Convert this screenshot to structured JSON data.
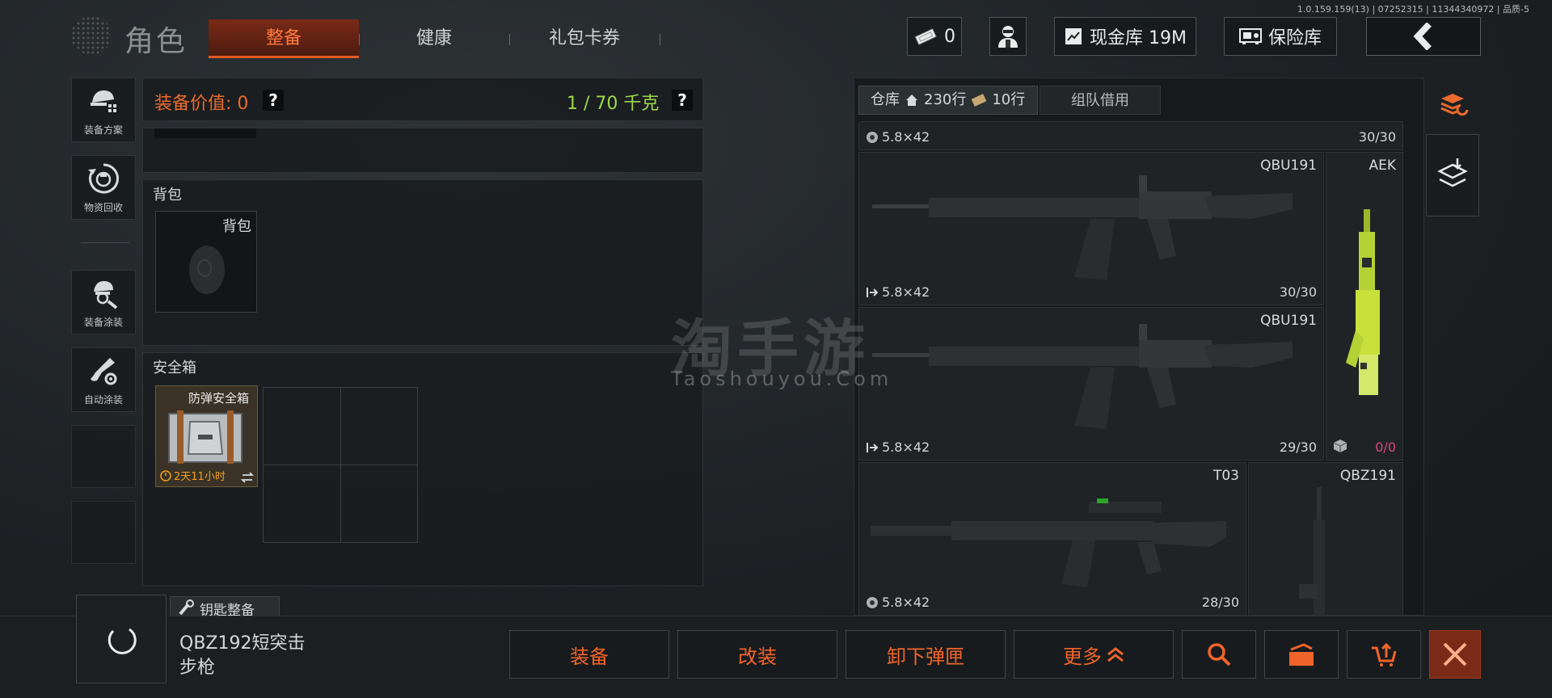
{
  "version": "1.0.159.159(13) | 07252315 | 11344340972 | 品质-5",
  "header": {
    "title": "角色",
    "tabs": [
      "整备",
      "健康",
      "礼包卡券"
    ],
    "active_tab": 0,
    "currency_value": "0",
    "cash_label": "现金库 19M",
    "safe_label": "保险库"
  },
  "sidebar": {
    "items": [
      {
        "label": "装备方案",
        "icon": "helmet-plan-icon"
      },
      {
        "label": "物资回收",
        "icon": "recycle-icon"
      },
      {
        "label": "装备涂装",
        "icon": "soldier-paint-icon"
      },
      {
        "label": "自动涂装",
        "icon": "brush-gear-icon"
      }
    ]
  },
  "loadout": {
    "value_label": "装备价值: 0",
    "weight_label": "1 / 70 千克",
    "help": "?",
    "backpack_section": "背包",
    "backpack_slot": "背包",
    "safebox_section": "安全箱",
    "safebox_name": "防弹安全箱",
    "safebox_timer": "2天11小时",
    "key_loadout": "钥匙整备"
  },
  "warehouse": {
    "tab_label": "仓库",
    "rows_label": "230行",
    "extra_rows_label": "10行",
    "team_tab": "组队借用",
    "top_row": {
      "ammo": "5.8×42",
      "count": "30/30"
    },
    "items": [
      {
        "name": "QBU191",
        "ammo": "5.8×42",
        "count": "30/30"
      },
      {
        "name": "QBU191",
        "ammo": "5.8×42",
        "count": "29/30"
      },
      {
        "name": "T03",
        "ammo": "5.8×42",
        "count": "28/30"
      }
    ],
    "side_items": [
      {
        "name": "AEK",
        "count": "0/0"
      },
      {
        "name": "QBZ191"
      }
    ]
  },
  "selected_item": {
    "name_line1": "QBZ192短突击",
    "name_line2": "步枪"
  },
  "actions": {
    "equip": "装备",
    "modify": "改装",
    "unload": "卸下弹匣",
    "more": "更多"
  },
  "watermark": {
    "main": "淘手游",
    "sub": "Taoshouyou.Com"
  },
  "colors": {
    "accent": "#ea6a2e",
    "weight_green": "#9cd94a",
    "zero_pink": "#e0457a"
  }
}
